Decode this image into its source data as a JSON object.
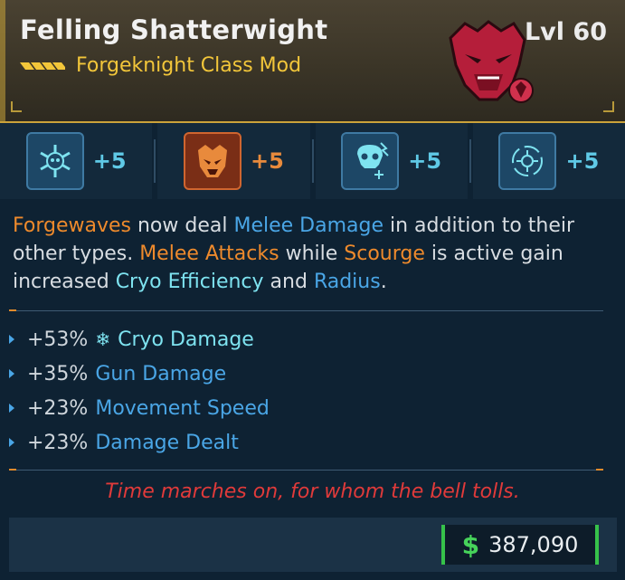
{
  "item": {
    "title": "Felling Shatterwight",
    "rarity_label": "Forgeknight Class Mod",
    "level": "Lvl 60"
  },
  "skills": [
    {
      "value": "+5",
      "icon": "skull-snowflake-icon",
      "tone": "blue"
    },
    {
      "value": "+5",
      "icon": "demon-face-icon",
      "tone": "orange"
    },
    {
      "value": "+5",
      "icon": "skull-frost-icon",
      "tone": "blue"
    },
    {
      "value": "+5",
      "icon": "target-rotate-icon",
      "tone": "blue"
    }
  ],
  "description": {
    "w1": "Forgewaves",
    "t1": " now deal ",
    "w2": "Melee Damage",
    "t2": " in addition to their other types. ",
    "w3": "Melee Attacks",
    "t3": " while ",
    "w4": "Scourge",
    "t4": " is active gain increased ",
    "w5": "Cryo Efficiency",
    "t5": " and ",
    "w6": "Radius",
    "t6": "."
  },
  "stats": [
    {
      "pct": "+53%",
      "name": "Cryo Damage",
      "icon": "snowflake-icon"
    },
    {
      "pct": "+35%",
      "name": "Gun Damage"
    },
    {
      "pct": "+23%",
      "name": "Movement Speed"
    },
    {
      "pct": "+23%",
      "name": "Damage Dealt"
    }
  ],
  "flavor": "Time marches on, for whom the bell tolls.",
  "price": {
    "currency": "$",
    "amount": "387,090"
  },
  "colors": {
    "rarity": "#f2c63a",
    "orange_keyword": "#ee8a2c",
    "blue_keyword": "#4aa6e6",
    "flavor": "#e03a3a",
    "money": "#46d35a"
  }
}
